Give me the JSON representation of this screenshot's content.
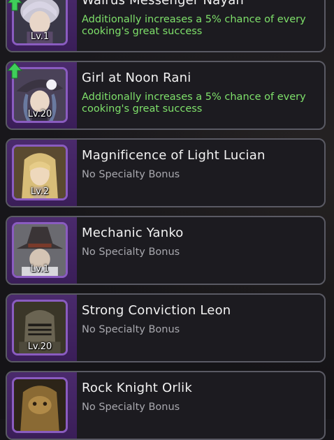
{
  "characters": [
    {
      "name": "Walrus Messenger Nayan",
      "level": "Lv.1",
      "bonus": "Additionally increases a 5% chance of every cooking's great success",
      "bonus_active": true,
      "upgrade_available": true
    },
    {
      "name": "Girl at Noon Rani",
      "level": "Lv.20",
      "bonus": "Additionally increases a 5% chance of every cooking's great success",
      "bonus_active": true,
      "upgrade_available": true
    },
    {
      "name": "Magnificence of Light Lucian",
      "level": "Lv.2",
      "bonus": "No Specialty Bonus",
      "bonus_active": false,
      "upgrade_available": false
    },
    {
      "name": "Mechanic Yanko",
      "level": "Lv.1",
      "bonus": "No Specialty Bonus",
      "bonus_active": false,
      "upgrade_available": false
    },
    {
      "name": "Strong Conviction Leon",
      "level": "Lv.20",
      "bonus": "No Specialty Bonus",
      "bonus_active": false,
      "upgrade_available": false
    },
    {
      "name": "Rock Knight Orlik",
      "level": "",
      "bonus": "No Specialty Bonus",
      "bonus_active": false,
      "upgrade_available": false
    }
  ],
  "colors": {
    "bonus_active": "#7ee06a",
    "bonus_none": "#a8a8ae",
    "portrait_frame": "#8a5cc0",
    "portrait_panel": "#4a2a6c",
    "upgrade_arrow": "#3fce5a"
  }
}
